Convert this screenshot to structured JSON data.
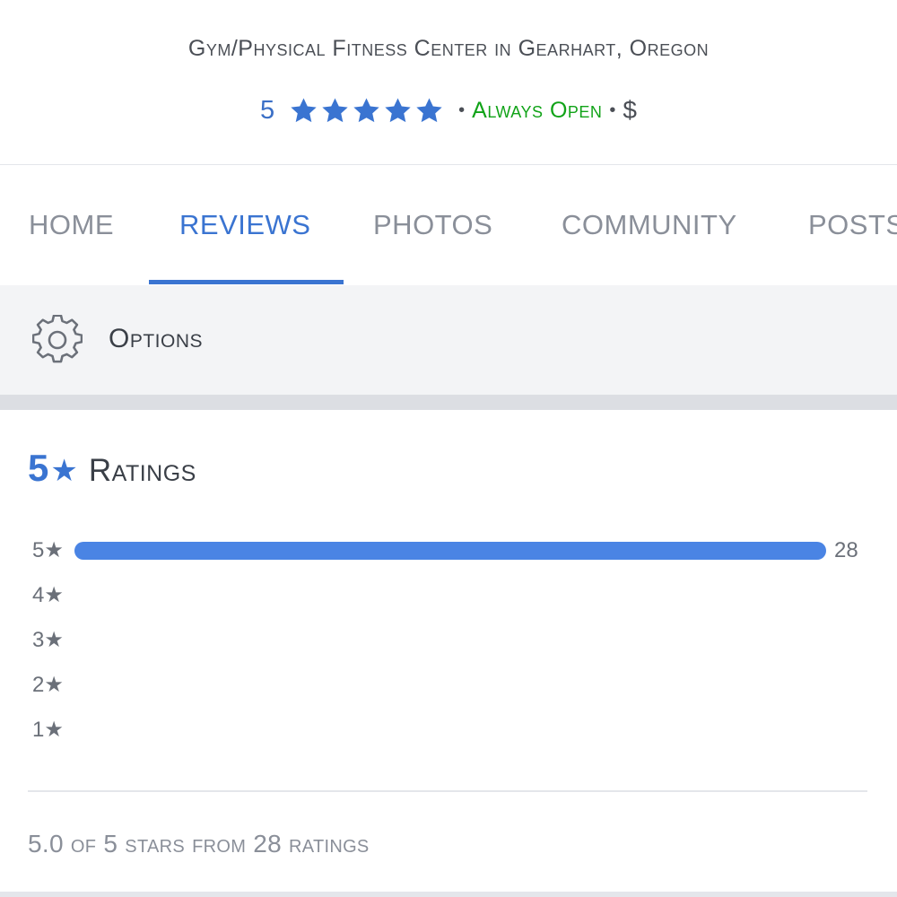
{
  "header": {
    "category": "Gym/Physical Fitness Center in Gearhart, Oregon",
    "rating": "5",
    "star_count": 5,
    "separator": "•",
    "status": "Always Open",
    "price": "$"
  },
  "tabs": [
    {
      "label": "HOME",
      "active": false
    },
    {
      "label": "REVIEWS",
      "active": true
    },
    {
      "label": "PHOTOS",
      "active": false
    },
    {
      "label": "COMMUNITY",
      "active": false
    },
    {
      "label": "POSTS",
      "active": false
    }
  ],
  "options": {
    "icon": "gear-icon",
    "label": "Options"
  },
  "ratings": {
    "score": "5",
    "star": "★",
    "title": "Ratings",
    "breakdown": [
      {
        "label": "5★",
        "count": 28,
        "count_text": "28",
        "fraction": 1.0
      },
      {
        "label": "4★",
        "count": 0,
        "count_text": "",
        "fraction": 0
      },
      {
        "label": "3★",
        "count": 0,
        "count_text": "",
        "fraction": 0
      },
      {
        "label": "2★",
        "count": 0,
        "count_text": "",
        "fraction": 0
      },
      {
        "label": "1★",
        "count": 0,
        "count_text": "",
        "fraction": 0
      }
    ],
    "summary": "5.0 of 5 stars from 28 ratings"
  },
  "colors": {
    "accent": "#3a74d1",
    "bar": "#4a84e4",
    "open_green": "#11a318",
    "text_muted": "#8a8f99"
  }
}
